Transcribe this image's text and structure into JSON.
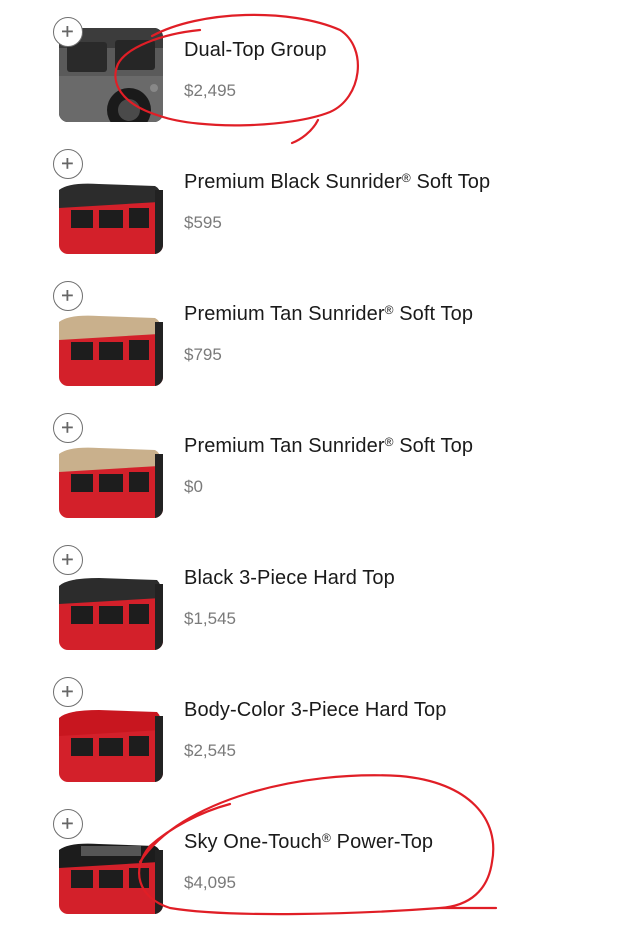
{
  "options": [
    {
      "name": "Dual-Top Group",
      "reg": "",
      "name_suffix": "",
      "price": "$2,495",
      "thumb": "gray"
    },
    {
      "name": "Premium Black Sunrider",
      "reg": "®",
      "name_suffix": " Soft Top",
      "price": "$595",
      "thumb": "black"
    },
    {
      "name": "Premium Tan Sunrider",
      "reg": "®",
      "name_suffix": " Soft Top",
      "price": "$795",
      "thumb": "tan"
    },
    {
      "name": "Premium Tan Sunrider",
      "reg": "®",
      "name_suffix": " Soft Top",
      "price": "$0",
      "thumb": "tan"
    },
    {
      "name": "Black 3-Piece Hard Top",
      "reg": "",
      "name_suffix": "",
      "price": "$1,545",
      "thumb": "black"
    },
    {
      "name": "Body-Color 3-Piece Hard Top",
      "reg": "",
      "name_suffix": "",
      "price": "$2,545",
      "thumb": "red"
    },
    {
      "name": "Sky One-Touch",
      "reg": "®",
      "name_suffix": " Power-Top",
      "price": "$4,095",
      "thumb": "sky"
    }
  ],
  "colors": {
    "jeep_red": "#d3202a",
    "annotation_red": "#e01e26",
    "tan_top": "#c9b08c",
    "black_top": "#2c2c2c",
    "add_border": "#6f6f6f",
    "price_text": "#7a7a7a"
  },
  "icons": {
    "add": "plus-circle-icon"
  }
}
